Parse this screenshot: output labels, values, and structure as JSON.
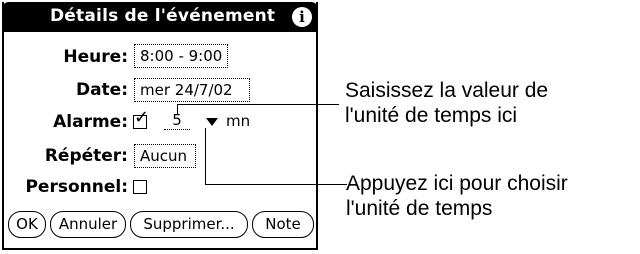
{
  "dialog": {
    "title": "Détails de l'événement",
    "info_icon": "i",
    "time_label": "Heure:",
    "time_value": "8:00 - 9:00",
    "date_label": "Date:",
    "date_value": "mer 24/7/02",
    "alarm_label": "Alarme:",
    "alarm_checked": true,
    "alarm_checkmark": "✓",
    "alarm_value": "5",
    "alarm_unit": "mn",
    "repeat_label": "Répéter:",
    "repeat_value": "Aucun",
    "private_label": "Personnel:",
    "private_checked": false
  },
  "buttons": {
    "ok": "OK",
    "cancel": "Annuler",
    "delete": "Supprimer...",
    "note": "Note"
  },
  "callouts": {
    "unit_value_line1": "Saisissez la valeur de",
    "unit_value_line2": "l'unité de temps ici",
    "unit_choose_line1": "Appuyez ici pour choisir",
    "unit_choose_line2": "l'unité de temps"
  },
  "icons": {
    "info": "info-icon",
    "trigger": "triangle-down-icon",
    "checkbox": "checkbox-icon"
  },
  "colors": {
    "title_bar": "#000000",
    "background": "#ffffff",
    "text": "#000000"
  }
}
